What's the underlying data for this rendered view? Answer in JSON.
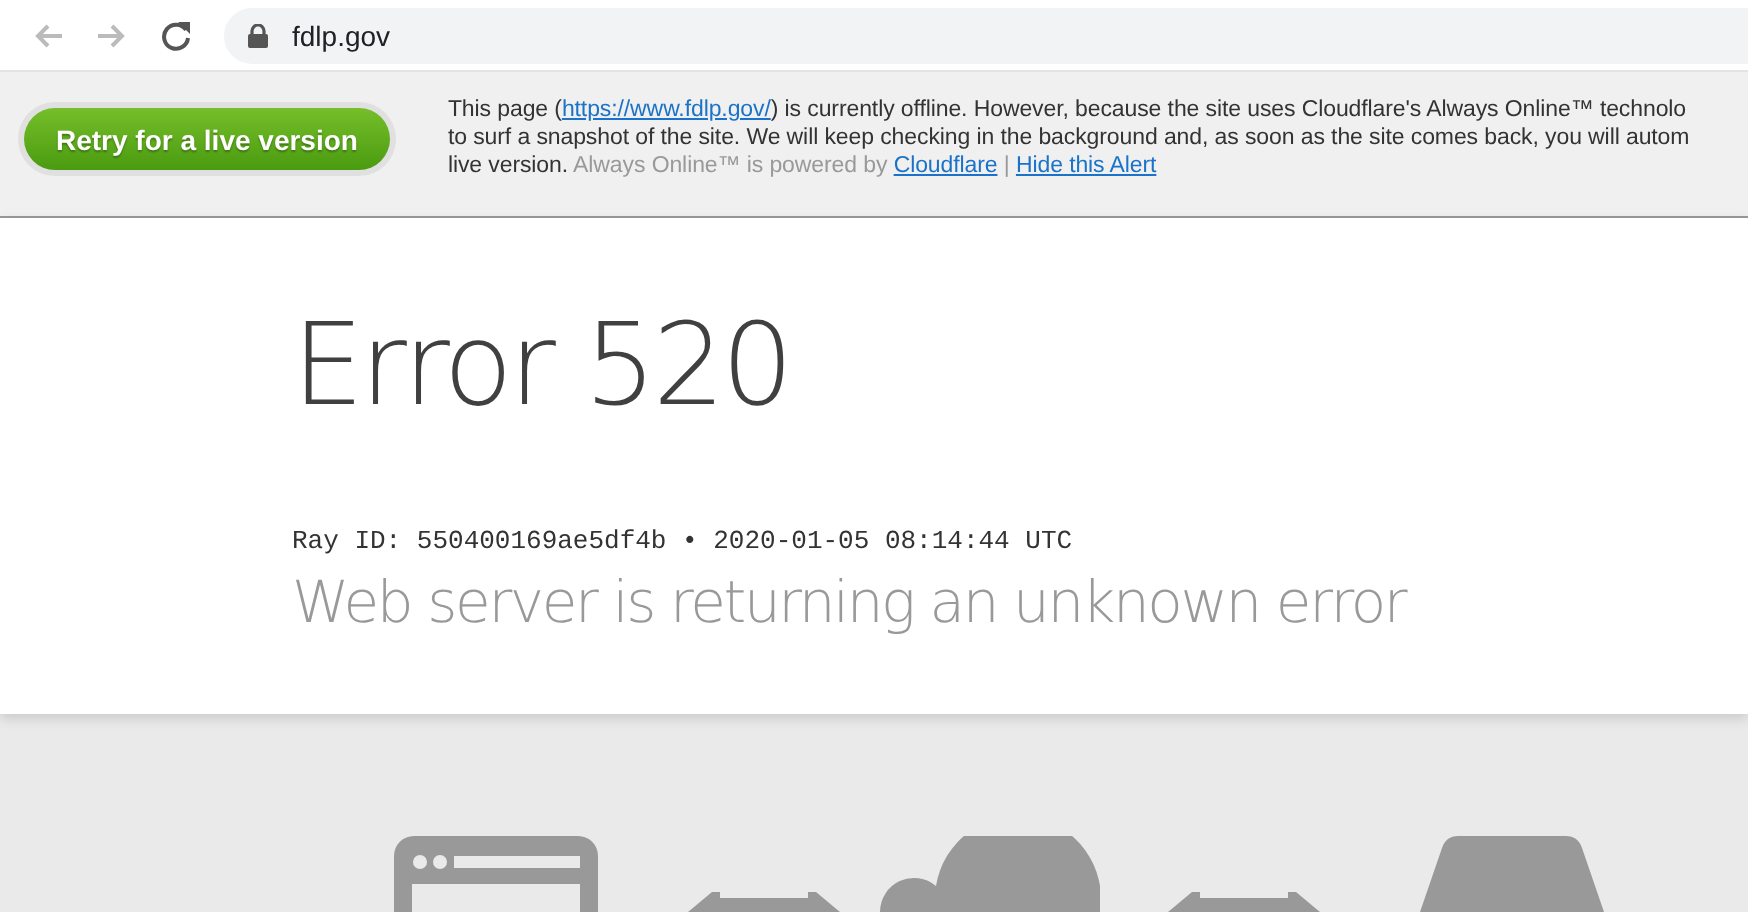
{
  "browser": {
    "url": "fdlp.gov"
  },
  "alert": {
    "button": "Retry for a live version",
    "lines": [
      [
        {
          "kind": "text",
          "text": "This page ("
        },
        {
          "kind": "link",
          "text": "https://www.fdlp.gov/"
        },
        {
          "kind": "text",
          "text": ") is currently offline. However, because the site uses Cloudflare's Always Online™ technolo"
        }
      ],
      [
        {
          "kind": "text",
          "text": "to surf a snapshot of the site. We will keep checking in the background and, as soon as the site comes back, you will autom"
        }
      ],
      [
        {
          "kind": "text",
          "text": "live version. "
        },
        {
          "kind": "muted",
          "text": "Always Online™ is powered by "
        },
        {
          "kind": "link",
          "text": "Cloudflare"
        },
        {
          "kind": "muted",
          "text": " | "
        },
        {
          "kind": "link",
          "text": "Hide this Alert"
        }
      ]
    ]
  },
  "error": {
    "title": "Error 520",
    "ray": "Ray ID: 550400169ae5df4b • 2020-01-05 08:14:44 UTC",
    "message": "Web server is returning an unknown error"
  }
}
